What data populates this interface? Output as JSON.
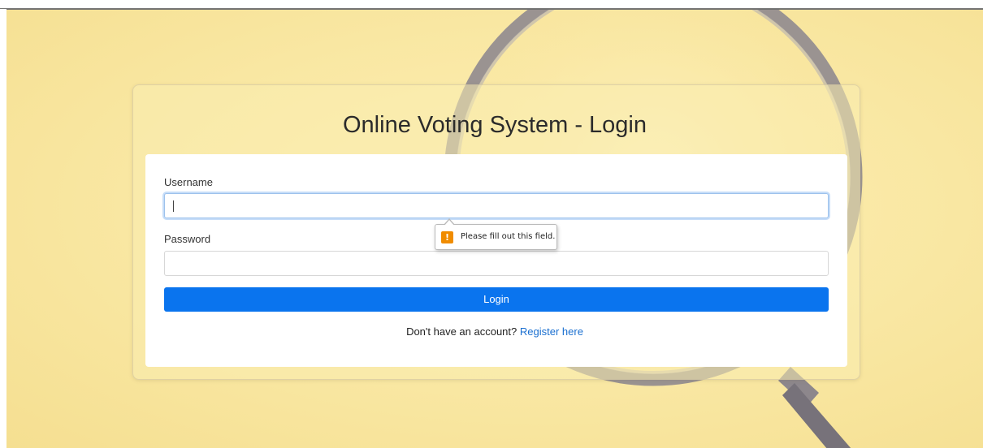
{
  "page": {
    "title": "Online Voting System - Login"
  },
  "form": {
    "username_label": "Username",
    "username_value": "",
    "password_label": "Password",
    "password_value": "",
    "login_label": "Login"
  },
  "validation_tooltip": {
    "icon": "warning-icon",
    "icon_glyph": "!",
    "message": "Please fill out this field."
  },
  "register": {
    "prompt": "Don't have an account?",
    "link_label": "Register here"
  },
  "colors": {
    "background": "#f9e7a2",
    "primary_button": "#0a74ee",
    "link": "#1a6fd0",
    "warning": "#f08c00"
  }
}
